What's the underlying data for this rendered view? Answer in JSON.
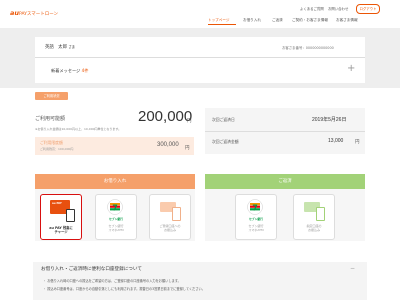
{
  "header": {
    "logo_brand": "au",
    "logo_text": "PAYスマートローン",
    "top_links": [
      "よくあるご質問",
      "お問い合わせ"
    ],
    "logout_label": "ログアウト",
    "nav": [
      "トップページ",
      "お借り入れ",
      "ご返済",
      "ご契約・お客さま情報",
      "お客さま情報"
    ]
  },
  "user": {
    "name": "英語　太郎",
    "honorific": "さま",
    "member_no": "お客さま番号：0000000000000"
  },
  "message": {
    "label": "新着メッセージ",
    "count": "4件"
  },
  "status_tag": "ご利用状況",
  "usage": {
    "label": "ご利用可能額",
    "amount": "200,000",
    "yen": "円",
    "note": "※お借り入れ金額は10,000円以上、10,000円単位となります。",
    "limit_label": "ご利用限度額",
    "limit_sub": "ご利用残高：100,000円",
    "limit_value": "300,000",
    "limit_yen": "円"
  },
  "repayment": {
    "date_label": "次回ご返済日",
    "date_value": "2019年5月26日",
    "amount_label": "次回ご返済金額",
    "amount_value": "13,000",
    "amount_yen": "円"
  },
  "borrow": {
    "title": "お借り入れ",
    "tiles": [
      {
        "line1": "au PAY 残高に",
        "line2": "チャージ"
      },
      {
        "line1": "セブン銀行",
        "line2": "スマホATM"
      },
      {
        "line1": "ご登録口座への",
        "line2": "お振込み"
      }
    ],
    "logo_text": "au PAY",
    "seven_text": "セブン銀行"
  },
  "repay_section": {
    "title": "ご返済",
    "tiles": [
      {
        "line1": "セブン銀行",
        "line2": "スマホATM"
      },
      {
        "line1": "指定口座の",
        "line2": "お振込み"
      }
    ],
    "seven_text": "セブン銀行"
  },
  "info": {
    "title": "お借り入れ・ご返済時に便利な口座登録について",
    "items": [
      "・ お借り入れ時の口座への振込をご希望の方は、ご登録口座の口座番号の入力をお願いします。",
      "・ 振込み口座番号は、口座からの自動引落としにも利用されます。振替日の3営業日前までに登録してください。"
    ]
  }
}
